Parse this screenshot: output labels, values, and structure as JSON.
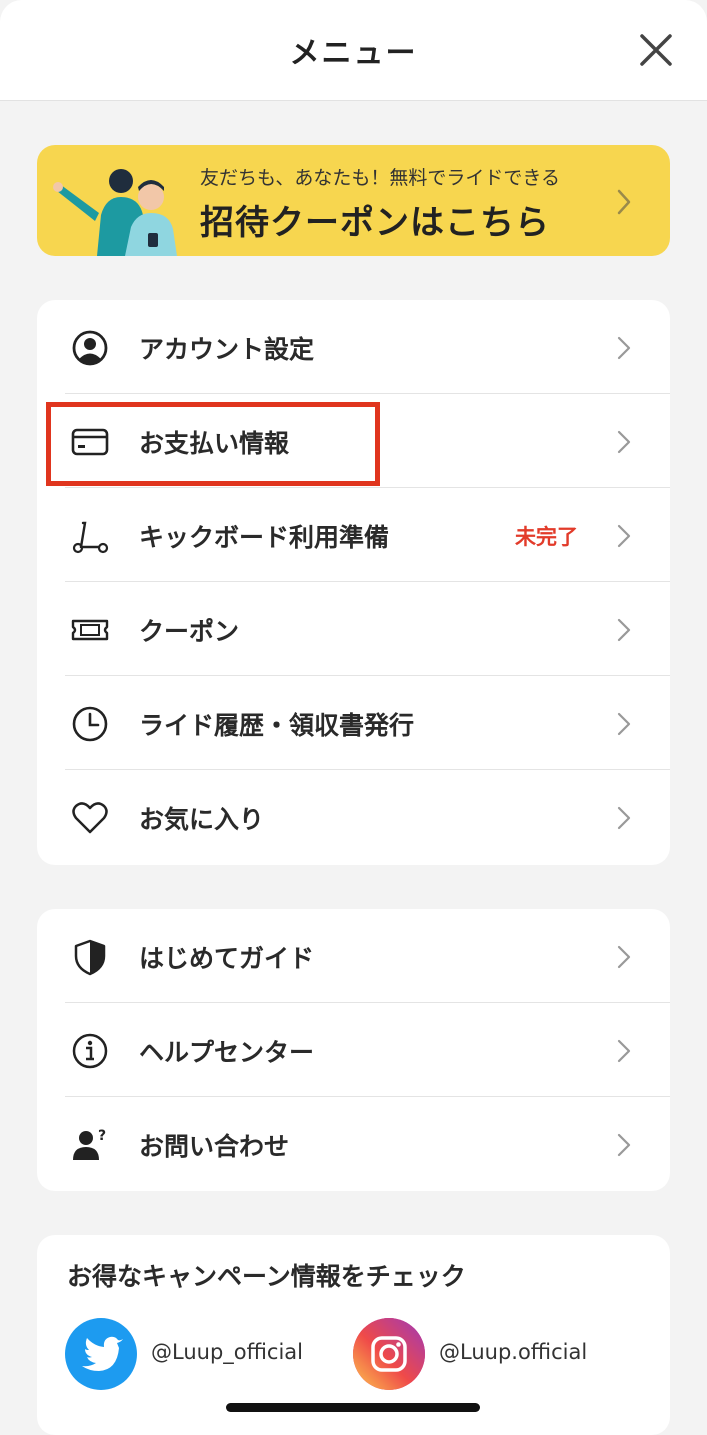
{
  "header": {
    "title": "メニュー"
  },
  "banner": {
    "subtitle": "友だちも、あなたも！無料でライドできる",
    "title": "招待クーポンはこちら"
  },
  "menu_main": [
    {
      "label": "アカウント設定",
      "icon": "account-icon",
      "badge": ""
    },
    {
      "label": "お支払い情報",
      "icon": "credit-card-icon",
      "badge": ""
    },
    {
      "label": "キックボード利用準備",
      "icon": "kickboard-icon",
      "badge": "未完了"
    },
    {
      "label": "クーポン",
      "icon": "ticket-icon",
      "badge": ""
    },
    {
      "label": "ライド履歴・領収書発行",
      "icon": "clock-icon",
      "badge": ""
    },
    {
      "label": "お気に入り",
      "icon": "heart-icon",
      "badge": ""
    }
  ],
  "menu_support": [
    {
      "label": "はじめてガイド",
      "icon": "shield-icon"
    },
    {
      "label": "ヘルプセンター",
      "icon": "info-icon"
    },
    {
      "label": "お問い合わせ",
      "icon": "person-question-icon"
    }
  ],
  "campaign": {
    "title": "お得なキャンペーン情報をチェック",
    "twitter": "@Luup_official",
    "instagram": "@Luup.official"
  },
  "colors": {
    "banner_bg": "#f7d64f",
    "badge": "#e23b2a",
    "highlight": "#e0351e",
    "twitter": "#1d9bf0"
  }
}
